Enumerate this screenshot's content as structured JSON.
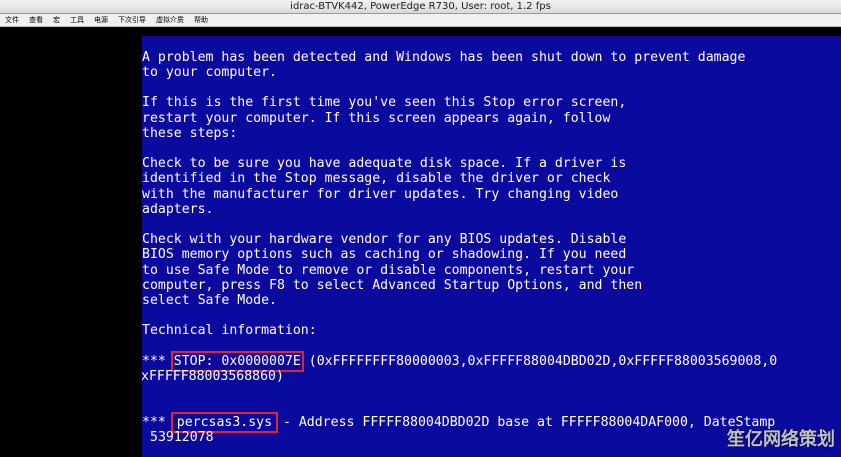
{
  "window": {
    "title": "idrac-BTVK442, PowerEdge R730, User: root, 1.2 fps"
  },
  "menu": [
    "文件",
    "查看",
    "宏",
    "工具",
    "电源",
    "下次引导",
    "虚拟介质",
    "帮助"
  ],
  "bsod": {
    "p1": [
      "A problem has been detected and Windows has been shut down to prevent damage",
      "to your computer."
    ],
    "p2": [
      "If this is the first time you've seen this Stop error screen,",
      "restart your computer. If this screen appears again, follow",
      "these steps:"
    ],
    "p3": [
      "Check to be sure you have adequate disk space. If a driver is",
      "identified in the Stop message, disable the driver or check",
      "with the manufacturer for driver updates. Try changing video",
      "adapters."
    ],
    "p4": [
      "Check with your hardware vendor for any BIOS updates. Disable",
      "BIOS memory options such as caching or shadowing. If you need",
      "to use Safe Mode to remove or disable components, restart your",
      "computer, press F8 to select Advanced Startup Options, and then",
      "select Safe Mode."
    ],
    "tech_header": "Technical information:",
    "stop_prefix": "*** ",
    "stop_code": "STOP: 0x0000007E",
    "stop_params": " (0xFFFFFFFF80000003,0xFFFFF88004DBD02D,0xFFFFF88003569008,0",
    "stop_params2": "xFFFFF88003568860)",
    "driver_prefix": "*** ",
    "driver_name": "percsas3.sys",
    "driver_rest": " - Address FFFFF88004DBD02D base at FFFFF88004DAF000, DateStamp",
    "driver_rest2": "53912078"
  },
  "watermark": "笙亿网络策划"
}
